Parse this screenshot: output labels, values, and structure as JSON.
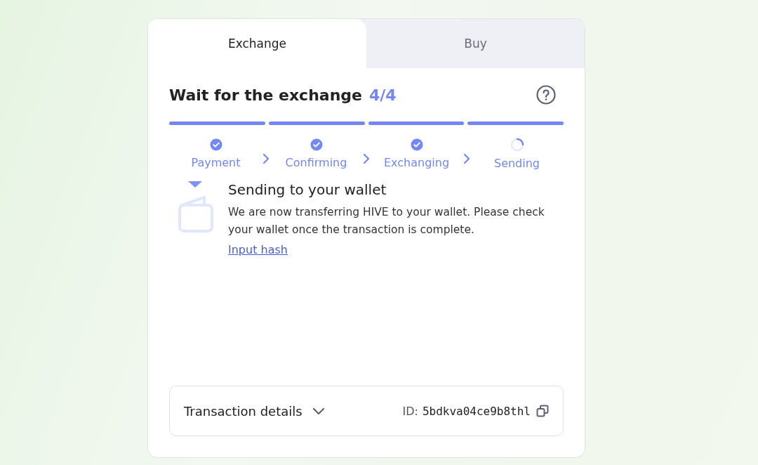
{
  "tabs": [
    {
      "label": "Exchange",
      "selected": true
    },
    {
      "label": "Buy",
      "selected": false
    }
  ],
  "header": {
    "title": "Wait for the exchange",
    "step_count": "4/4"
  },
  "steps": [
    {
      "label": "Payment",
      "completed": true
    },
    {
      "label": "Confirming",
      "completed": true
    },
    {
      "label": "Exchanging",
      "completed": true
    },
    {
      "label": "Sending",
      "completed": false
    }
  ],
  "message": {
    "title": "Sending to your wallet",
    "text": "We are now transferring HIVE to your wallet. Please check your wallet once the transaction is complete.",
    "link": "Input hash"
  },
  "details": {
    "label": "Transaction details",
    "expanded": false,
    "id_label": "ID:",
    "id_value": "5bdkva04ce9b8thl"
  }
}
